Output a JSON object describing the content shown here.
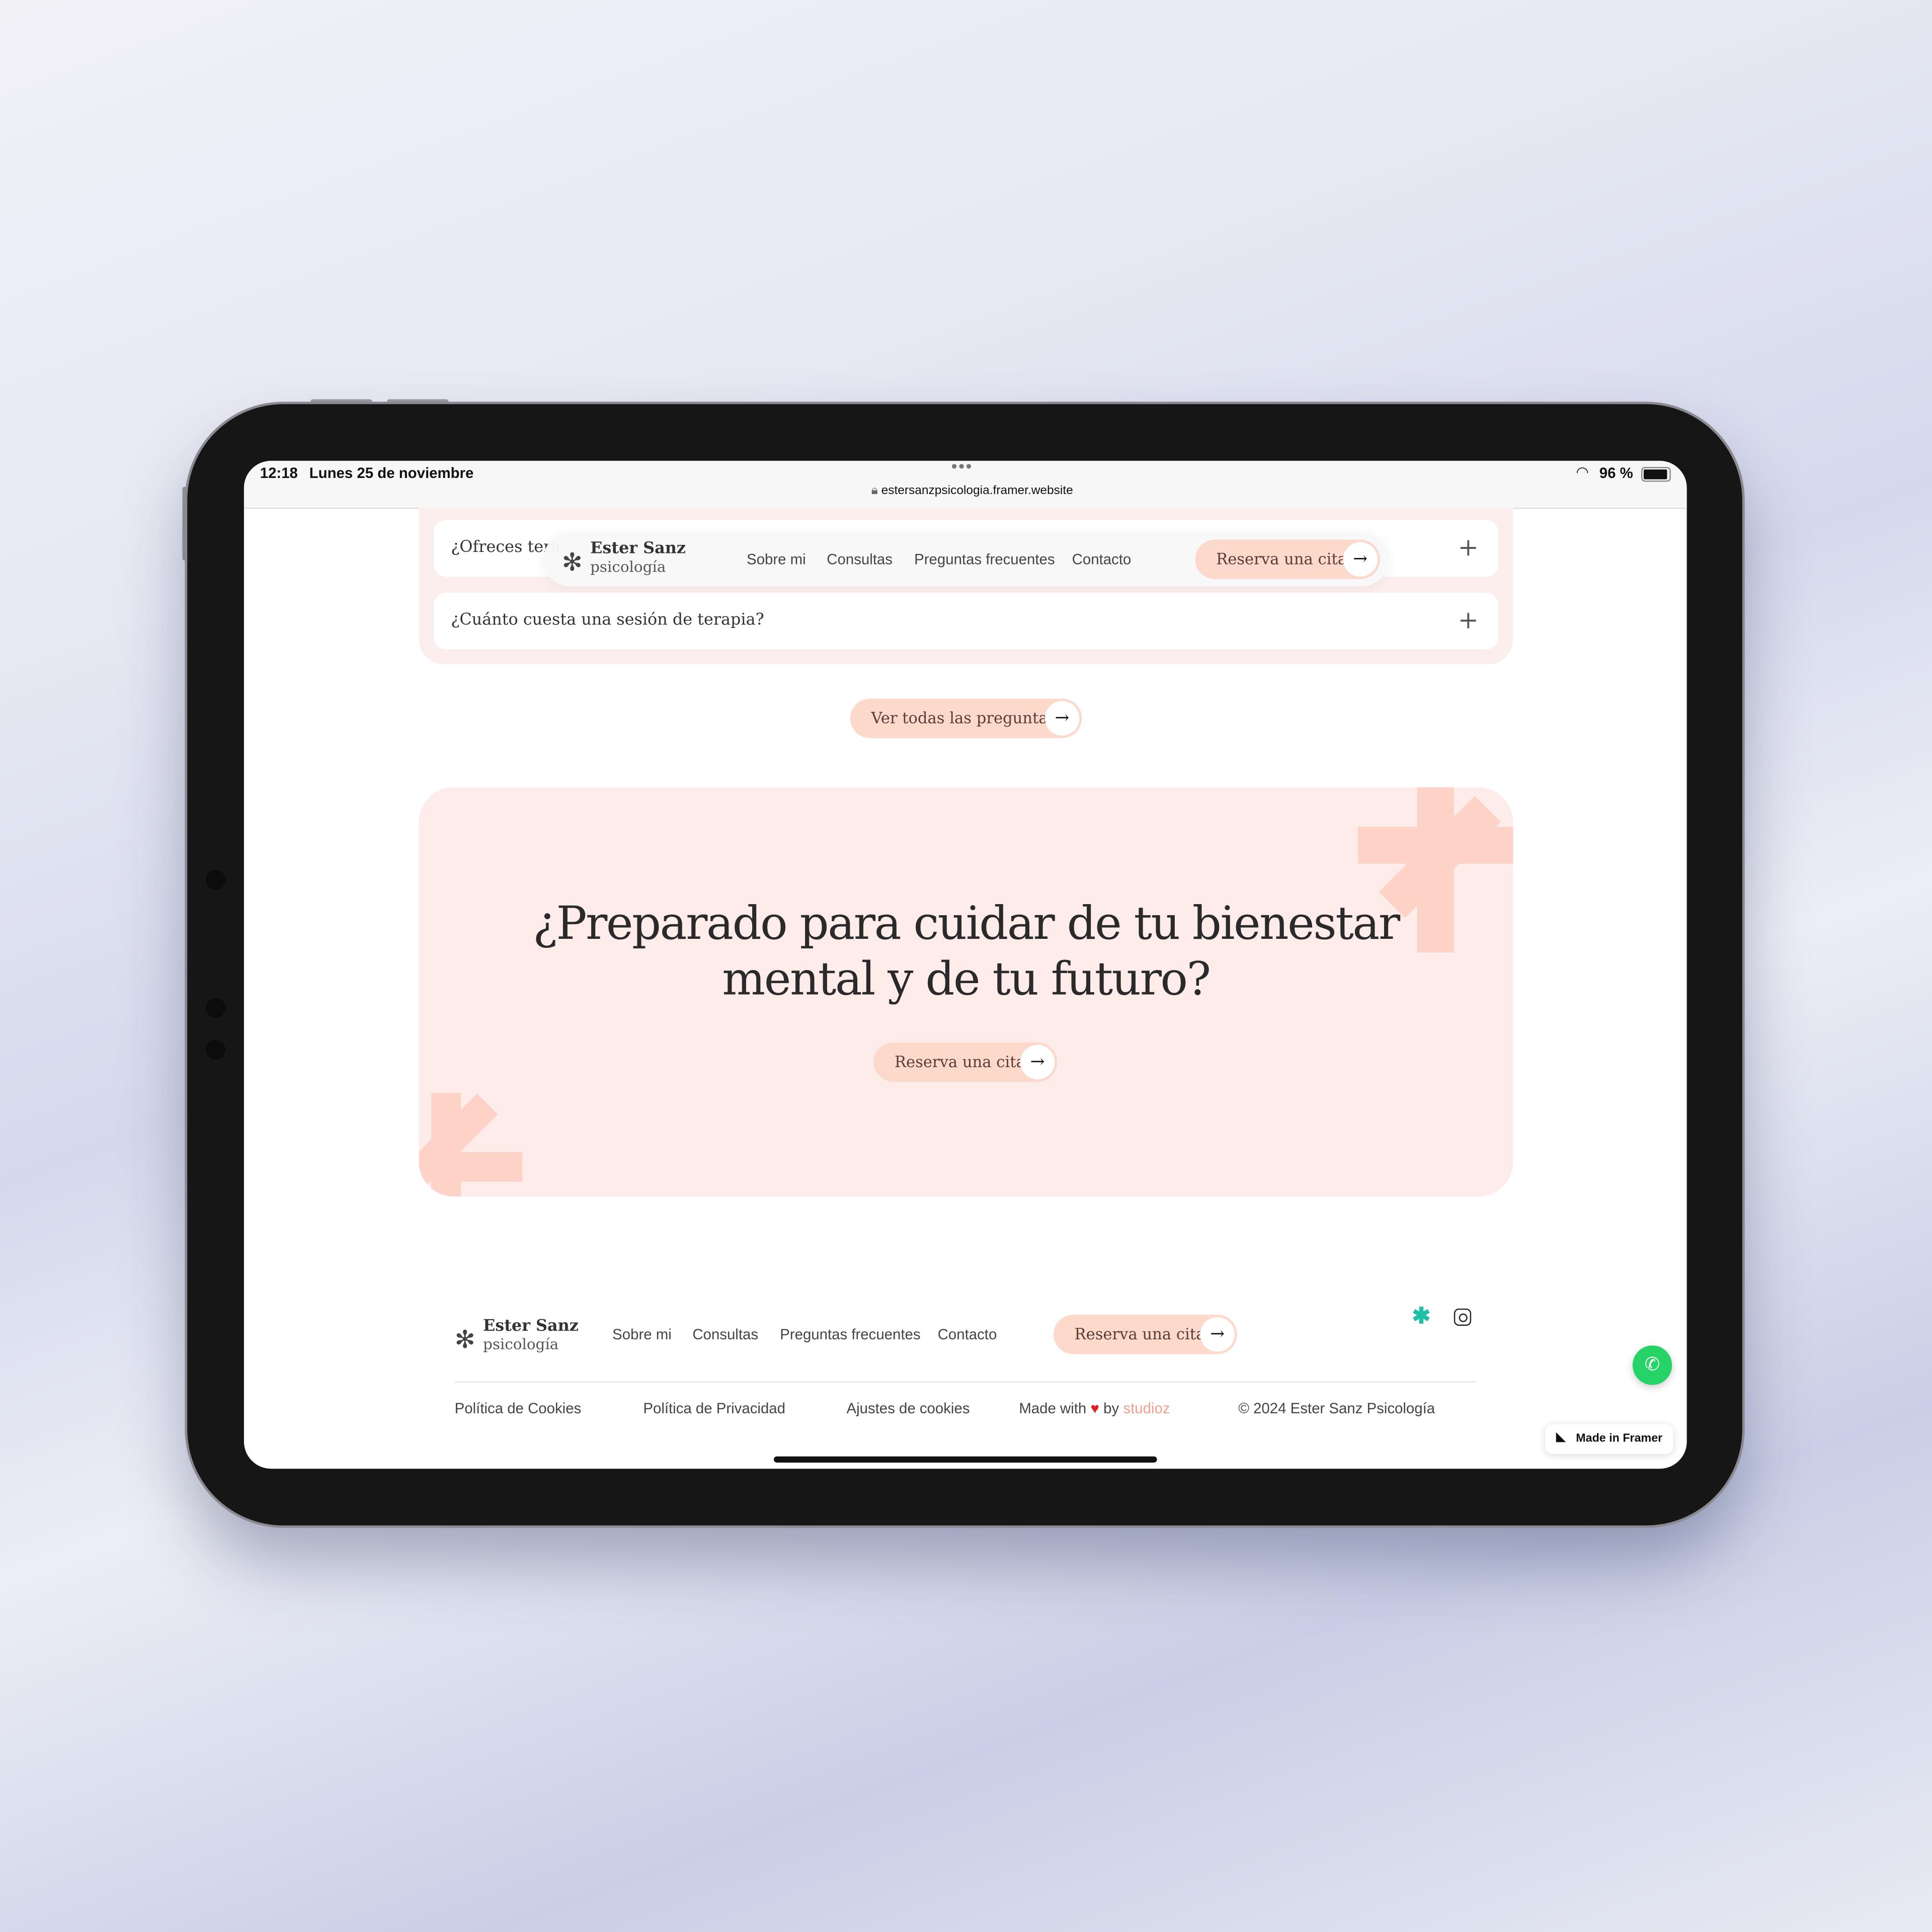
{
  "status_bar": {
    "time": "12:18",
    "date": "Lunes 25 de noviembre",
    "url": "estersanzpsicologia.framer.website",
    "battery": "96 %"
  },
  "nav": {
    "logo_name": "Ester Sanz",
    "logo_sub": "psicología",
    "links": [
      "Sobre mi",
      "Consultas",
      "Preguntas frecuentes",
      "Contacto"
    ],
    "cta": "Reserva una cita"
  },
  "faq": {
    "items": [
      "¿Ofreces tera",
      "¿Cuánto cuesta una sesión de terapia?"
    ],
    "more": "Ver todas las preguntas"
  },
  "cta_section": {
    "heading_line1": "¿Preparado para cuidar de tu bienestar",
    "heading_line2": "mental y de tu futuro?",
    "button": "Reserva una cita"
  },
  "footer": {
    "logo_name": "Ester Sanz",
    "logo_sub": "psicología",
    "links": [
      "Sobre mi",
      "Consultas",
      "Preguntas frecuentes",
      "Contacto"
    ],
    "cta": "Reserva una cita",
    "bottom": {
      "cookies": "Política de Cookies",
      "privacy": "Política de Privacidad",
      "settings": "Ajustes de cookies",
      "made_with": "Made with",
      "by": "by",
      "studio": "studioz",
      "copyright": "© 2024 Ester Sanz Psicología"
    }
  },
  "framer_badge": "Made in Framer",
  "colors": {
    "accent": "#fdd9cc",
    "card": "#fdecea",
    "whatsapp": "#25d366",
    "studio_link": "#f0a090",
    "social": "#1fbfa8"
  }
}
